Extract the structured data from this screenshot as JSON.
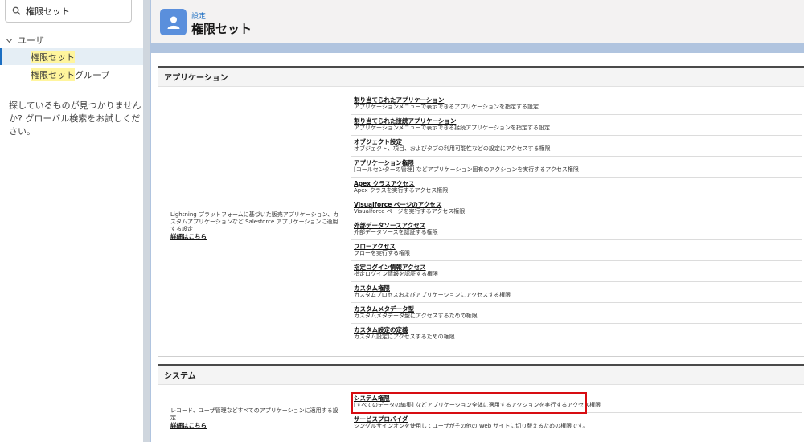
{
  "sidebar": {
    "search": {
      "value": "権限セット"
    },
    "group": {
      "label": "ユーザ"
    },
    "items": [
      {
        "label": "権限セット",
        "highlight": "権限セット",
        "rest": "",
        "selected": true
      },
      {
        "label": "権限セットグループ",
        "highlight": "権限セット",
        "rest": "グループ",
        "selected": false
      }
    ],
    "not_found": "探しているものが見つかりませんか? グローバル検索をお試しください。"
  },
  "header": {
    "breadcrumb": "設定",
    "title": "権限セット",
    "icon": "user-icon"
  },
  "sections": {
    "apps": {
      "heading": "アプリケーション",
      "description": "Lightning プラットフォームに基づいた販売アプリケーション、カスタムアプリケーションなど Salesforce アプリケーションに適用する設定",
      "more": "詳細はこちら",
      "links": [
        {
          "title": "割り当てられたアプリケーション",
          "desc": "アプリケーションメニューで表示できるアプリケーションを指定する設定"
        },
        {
          "title": "割り当てられた接続アプリケーション",
          "desc": "アプリケーションメニューで表示できる接続アプリケーションを指定する設定"
        },
        {
          "title": "オブジェクト設定",
          "desc": "オブジェクト、項目、およびタブの利用可能性などの設定にアクセスする権限"
        },
        {
          "title": "アプリケーション権限",
          "desc": "[コールセンターの管理] などアプリケーション固有のアクションを実行するアクセス権限"
        },
        {
          "title": "Apex クラスアクセス",
          "desc": "Apex クラスを実行するアクセス権限"
        },
        {
          "title": "Visualforce ページのアクセス",
          "desc": "Visualforce ページを実行するアクセス権限"
        },
        {
          "title": "外部データソースアクセス",
          "desc": "外部データソースを認証する権限"
        },
        {
          "title": "フローアクセス",
          "desc": "フローを実行する権限"
        },
        {
          "title": "指定ログイン情報アクセス",
          "desc": "指定ログイン情報を認証する権限"
        },
        {
          "title": "カスタム権限",
          "desc": "カスタムプロセスおよびアプリケーションにアクセスする権限"
        },
        {
          "title": "カスタムメタデータ型",
          "desc": "カスタムメタデータ型にアクセスするための権限"
        },
        {
          "title": "カスタム設定の定義",
          "desc": "カスタム設定にアクセスするための権限"
        }
      ]
    },
    "system": {
      "heading": "システム",
      "description": "レコード、ユーザ管理などすべてのアプリケーションに適用する設定",
      "more": "詳細はこちら",
      "links": [
        {
          "title": "システム権限",
          "desc": "[すべてのデータの編集] などアプリケーション全体に適用するアクションを実行するアクセス権限"
        },
        {
          "title": "サービスプロバイダ",
          "desc": "シングルサインオンを使用してユーザがその他の Web サイトに切り替えるための権限です。"
        }
      ]
    }
  },
  "colors": {
    "accent": "#1b6ec2",
    "highlight_bg": "#fff59d",
    "callout_border": "#d70d12",
    "header_icon_bg": "#5a8fdc",
    "main_backdrop": "#b0c4df"
  }
}
